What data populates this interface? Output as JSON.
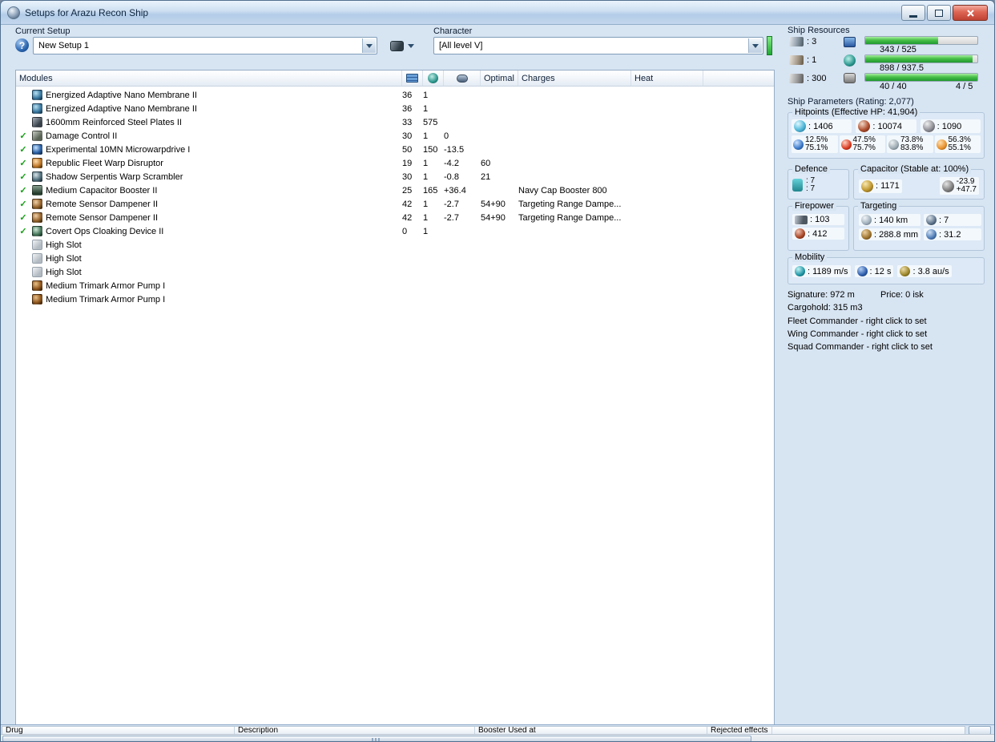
{
  "window": {
    "title": "Setups for Arazu Recon Ship"
  },
  "icons": {
    "help": "?"
  },
  "toolbar": {
    "current_setup_label": "Current Setup",
    "current_setup_value": "New Setup 1",
    "character_label": "Character",
    "character_value": "[All level V]"
  },
  "modules_table": {
    "headers": {
      "modules": "Modules",
      "optimal": "Optimal",
      "charges": "Charges",
      "heat": "Heat"
    },
    "rows": [
      {
        "check": "",
        "icon": "ic-membrane",
        "name": "Energized Adaptive Nano Membrane II",
        "cpu": "36",
        "pg": "1",
        "cap": "",
        "optimal": "",
        "charges": "",
        "heat": ""
      },
      {
        "check": "",
        "icon": "ic-membrane",
        "name": "Energized Adaptive Nano Membrane II",
        "cpu": "36",
        "pg": "1",
        "cap": "",
        "optimal": "",
        "charges": "",
        "heat": ""
      },
      {
        "check": "",
        "icon": "ic-plate",
        "name": "1600mm Reinforced Steel Plates II",
        "cpu": "33",
        "pg": "575",
        "cap": "",
        "optimal": "",
        "charges": "",
        "heat": ""
      },
      {
        "check": "✓",
        "icon": "ic-dcu",
        "name": "Damage Control II",
        "cpu": "30",
        "pg": "1",
        "cap": "0",
        "optimal": "",
        "charges": "",
        "heat": ""
      },
      {
        "check": "✓",
        "icon": "ic-mwd",
        "name": "Experimental 10MN Microwarpdrive I",
        "cpu": "50",
        "pg": "150",
        "cap": "-13.5",
        "optimal": "",
        "charges": "",
        "heat": ""
      },
      {
        "check": "✓",
        "icon": "ic-disruptor",
        "name": "Republic Fleet Warp Disruptor",
        "cpu": "19",
        "pg": "1",
        "cap": "-4.2",
        "optimal": "60",
        "charges": "",
        "heat": ""
      },
      {
        "check": "✓",
        "icon": "ic-scrambler",
        "name": "Shadow Serpentis Warp Scrambler",
        "cpu": "30",
        "pg": "1",
        "cap": "-0.8",
        "optimal": "21",
        "charges": "",
        "heat": ""
      },
      {
        "check": "✓",
        "icon": "ic-capbooster",
        "name": "Medium Capacitor Booster II",
        "cpu": "25",
        "pg": "165",
        "cap": "+36.4",
        "optimal": "",
        "charges": "Navy Cap Booster 800",
        "heat": ""
      },
      {
        "check": "✓",
        "icon": "ic-damp",
        "name": "Remote Sensor Dampener II",
        "cpu": "42",
        "pg": "1",
        "cap": "-2.7",
        "optimal": "54+90",
        "charges": "Targeting Range Dampe...",
        "heat": ""
      },
      {
        "check": "✓",
        "icon": "ic-damp",
        "name": "Remote Sensor Dampener II",
        "cpu": "42",
        "pg": "1",
        "cap": "-2.7",
        "optimal": "54+90",
        "charges": "Targeting Range Dampe...",
        "heat": ""
      },
      {
        "check": "✓",
        "icon": "ic-cloak",
        "name": "Covert Ops Cloaking Device II",
        "cpu": "0",
        "pg": "1",
        "cap": "",
        "optimal": "",
        "charges": "",
        "heat": ""
      },
      {
        "check": "",
        "icon": "ic-highslot",
        "name": "High Slot",
        "cpu": "",
        "pg": "",
        "cap": "",
        "optimal": "",
        "charges": "",
        "heat": ""
      },
      {
        "check": "",
        "icon": "ic-highslot",
        "name": "High Slot",
        "cpu": "",
        "pg": "",
        "cap": "",
        "optimal": "",
        "charges": "",
        "heat": ""
      },
      {
        "check": "",
        "icon": "ic-highslot",
        "name": "High Slot",
        "cpu": "",
        "pg": "",
        "cap": "",
        "optimal": "",
        "charges": "",
        "heat": ""
      },
      {
        "check": "",
        "icon": "ic-rig",
        "name": "Medium Trimark Armor Pump I",
        "cpu": "",
        "pg": "",
        "cap": "",
        "optimal": "",
        "charges": "",
        "heat": ""
      },
      {
        "check": "",
        "icon": "ic-rig",
        "name": "Medium Trimark Armor Pump I",
        "cpu": "",
        "pg": "",
        "cap": "",
        "optimal": "",
        "charges": "",
        "heat": ""
      }
    ]
  },
  "resources": {
    "label": "Ship Resources",
    "turrets": ": 3",
    "launchers": ": 1",
    "upgrades": ": 300",
    "cpu": {
      "text": "343 / 525",
      "pct": 65.3
    },
    "powergrid": {
      "text": "898 / 937.5",
      "pct": 95.8
    },
    "calibration": {
      "text": "40 / 40",
      "pct": 100
    },
    "rigs": "4 / 5"
  },
  "parameters": {
    "title": "Ship Parameters (Rating: 2,077)",
    "hitpoints": {
      "title": "Hitpoints (Effective HP: 41,904)",
      "shield": ": 1406",
      "armor": ": 10074",
      "hull": ": 1090",
      "resists": [
        {
          "icon": "i-em",
          "top": "12.5%",
          "bottom": "75.1%"
        },
        {
          "icon": "i-th",
          "top": "47.5%",
          "bottom": "75.7%"
        },
        {
          "icon": "i-ki",
          "top": "73.8%",
          "bottom": "83.8%"
        },
        {
          "icon": "i-ex",
          "top": "56.3%",
          "bottom": "55.1%"
        }
      ]
    },
    "defence": {
      "title": "Defence",
      "booster": ": 7",
      "transfer": ": 7"
    },
    "capacitor": {
      "title": "Capacitor (Stable at: 100%)",
      "capacity": ": 1171",
      "usage": "-23.9",
      "recharge": "+47.7"
    },
    "firepower": {
      "title": "Firepower",
      "dps": ": 103",
      "volley": ": 412"
    },
    "targeting": {
      "title": "Targeting",
      "range": ": 140 km",
      "max_targets": ": 7",
      "sig_resolution": ": 288.8 mm",
      "scan_resolution": ": 31.2"
    },
    "mobility": {
      "title": "Mobility",
      "speed": ": 1189 m/s",
      "align_time": ": 12 s",
      "warp_speed": ": 3.8 au/s"
    }
  },
  "footer": {
    "signature": "Signature: 972 m",
    "price": "Price: 0 isk",
    "cargohold": "Cargohold: 315 m3",
    "fleet": "Fleet Commander - right click to set",
    "wing": "Wing Commander - right click to set",
    "squad": "Squad Commander - right click to set"
  },
  "bottom_panel": {
    "columns": [
      {
        "label": "Drug"
      },
      {
        "label": "Description"
      },
      {
        "label": "Booster Used at"
      },
      {
        "label": "Rejected effects"
      }
    ]
  }
}
